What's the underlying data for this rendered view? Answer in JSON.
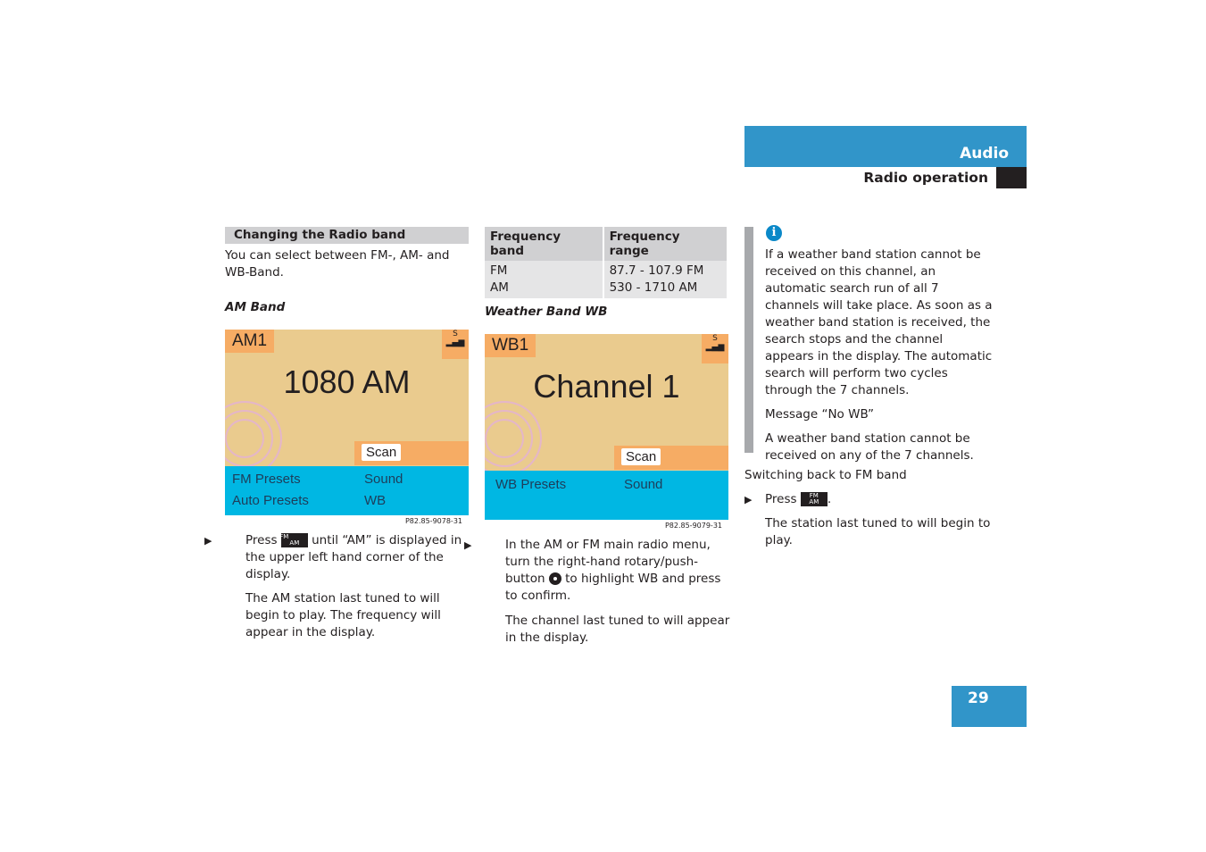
{
  "header": {
    "section": "Audio",
    "subsection": "Radio operation"
  },
  "col1": {
    "heading": "Changing the Radio band",
    "intro": "You can select between FM-, AM- and WB-Band.",
    "subheading": "AM Band",
    "display": {
      "band": "AM1",
      "signal": "S",
      "frequency": "1080 AM",
      "scan": "Scan",
      "menu": [
        "FM Presets",
        "Sound",
        "Auto Presets",
        "WB"
      ],
      "caption": "P82.85-9078-31"
    },
    "step_press": "Press",
    "key_label_top": "FM",
    "key_label_bottom": "AM",
    "step_rest": "until “AM” is displayed in the upper left hand corner of the display.",
    "result": "The AM station last tuned to will begin to play. The frequency will appear in the display."
  },
  "col2": {
    "table": {
      "headers": [
        "Frequency band",
        "Frequency range"
      ],
      "rows": [
        [
          "FM",
          "87.7 - 107.9 FM"
        ],
        [
          "AM",
          "530 - 1710 AM"
        ]
      ]
    },
    "subheading": "Weather Band WB",
    "display": {
      "band": "WB1",
      "signal": "S",
      "frequency": "Channel 1",
      "scan": "Scan",
      "menu": [
        "WB Presets",
        "Sound"
      ],
      "caption": "P82.85-9079-31"
    },
    "step_a": "In the AM or FM main radio menu, turn the right-hand rotary/push-button",
    "step_b": "to highlight WB and press to confirm.",
    "result": "The channel last tuned to will appear in the display."
  },
  "col3": {
    "info_icon": "info-icon",
    "info_text": "If a weather band station cannot be received on this channel, an automatic search run of all 7 channels will take place. As soon as a weather band station is received, the search stops and the channel appears in the display. The automatic search will perform two cycles through the 7 channels.",
    "message": "Message “No WB”",
    "message_text": "A weather band station cannot be received on any of the 7 channels.",
    "switch_heading": "Switching back to FM band",
    "step_press": "Press",
    "result": "The station last tuned to will begin to play."
  },
  "page_number": "29",
  "colors": {
    "accent": "#3195c9",
    "display_bg": "#eacb8e",
    "display_orange": "#f6ac64",
    "display_menu": "#00b7e3"
  }
}
